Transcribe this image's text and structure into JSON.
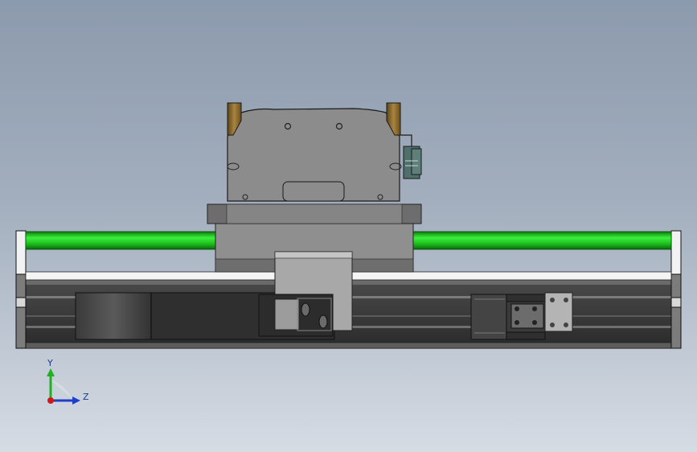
{
  "viewport": {
    "title": "",
    "background_top": "#8c9aad",
    "background_bottom": "#d6dce4"
  },
  "model": {
    "parts": [
      "linear-actuator-base",
      "slide-carriage",
      "gripper-body",
      "gripper-jaw-left",
      "gripper-jaw-right",
      "sensor-module",
      "guide-rod-left",
      "guide-rod-right",
      "cable-chain",
      "end-bracket"
    ],
    "colors": {
      "body_gray": "#9a9a9a",
      "dark_gray": "#3c3c3c",
      "rail_green": "#22c422",
      "jaw_gold": "#8a6a2c",
      "sensor_teal": "#4f6f6a",
      "rail_white": "#f4f4f4"
    }
  },
  "triad": {
    "y_label": "Y",
    "z_label": "Z",
    "y_color": "#22b022",
    "z_color": "#1f3fc8",
    "origin_color": "#d01818"
  }
}
